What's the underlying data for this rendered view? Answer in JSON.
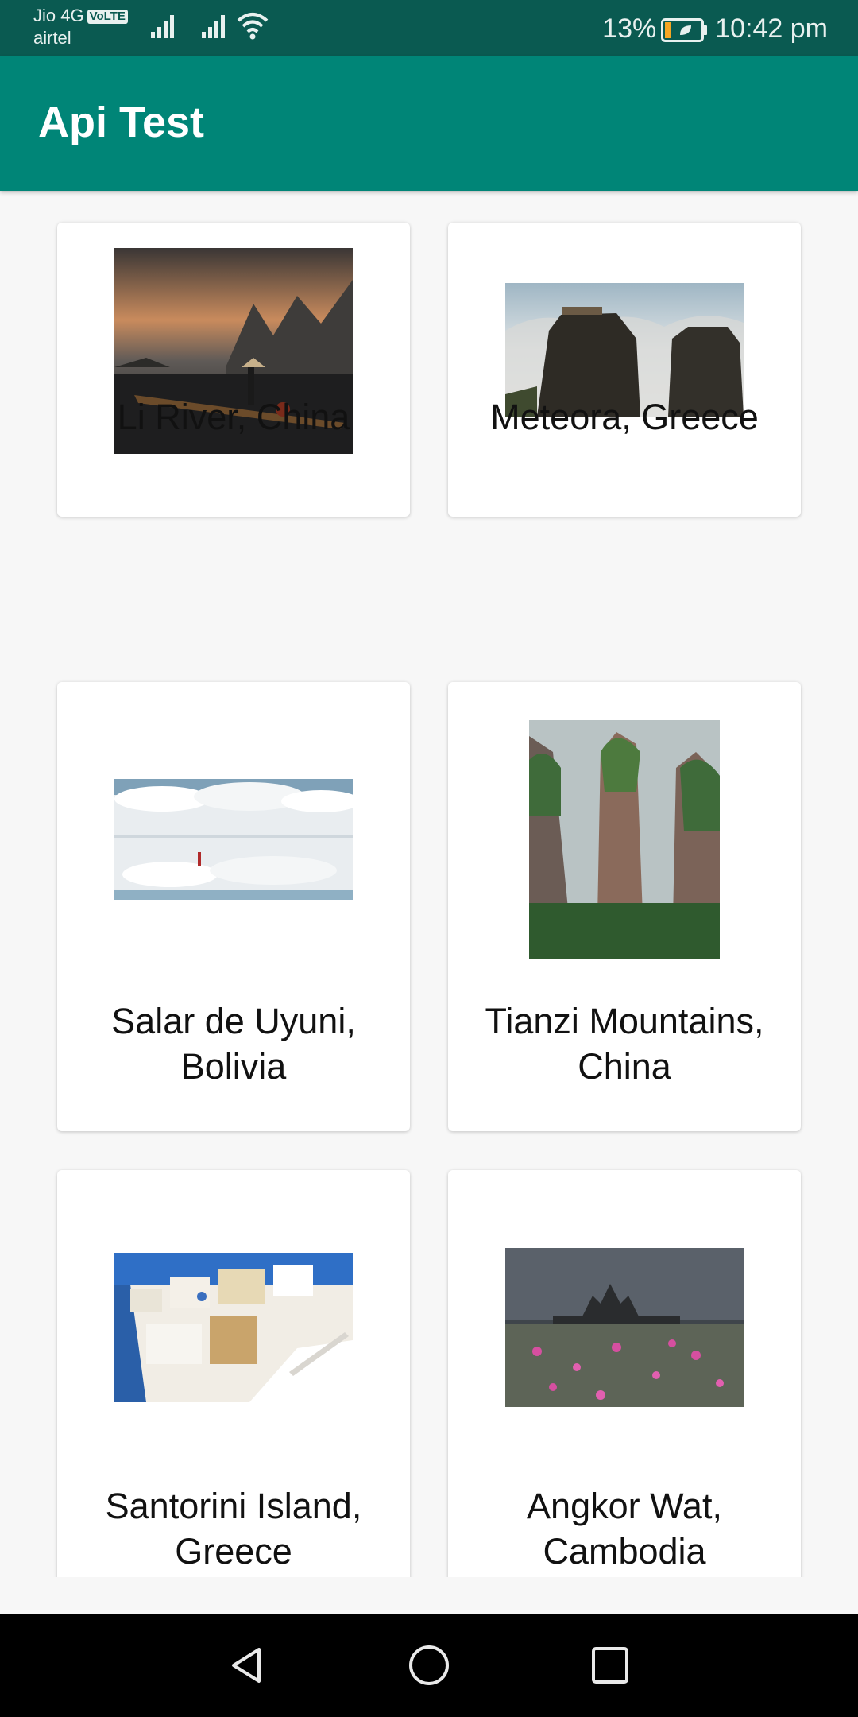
{
  "status_bar": {
    "carrier1": "Jio 4G",
    "volte": "VoLTE",
    "carrier2": "airtel",
    "battery": "13%",
    "time": "10:42 pm"
  },
  "app_bar": {
    "title": "Api Test"
  },
  "places": [
    {
      "name": "Li River, China"
    },
    {
      "name": "Meteora, Greece"
    },
    {
      "name": "Salar de Uyuni,\nBolivia"
    },
    {
      "name": "Tianzi Mountains,\nChina"
    },
    {
      "name": "Santorini Island,\nGreece"
    },
    {
      "name": "Angkor Wat,\nCambodia"
    }
  ],
  "icons": {
    "signal": "signal-icon",
    "wifi": "wifi-icon",
    "battery": "battery-icon",
    "back": "back-icon",
    "home": "home-icon",
    "recents": "recents-icon"
  },
  "colors": {
    "status_bar": "#0a5a51",
    "app_bar": "#008577",
    "background": "#f7f7f7",
    "card": "#ffffff",
    "nav_bar": "#000000"
  }
}
